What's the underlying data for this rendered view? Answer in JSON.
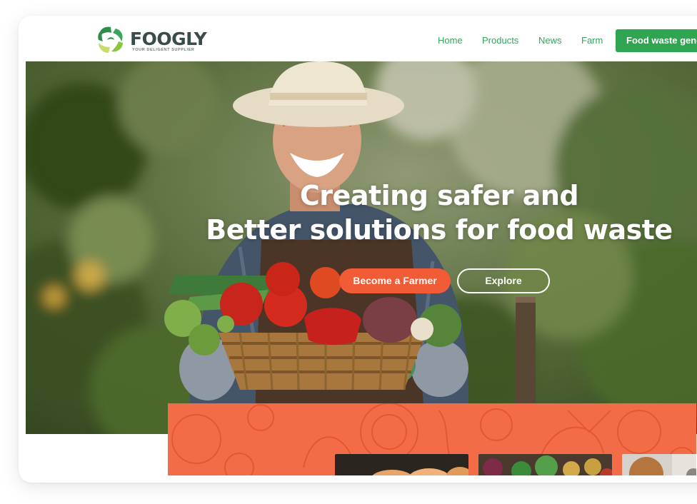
{
  "brand": {
    "name": "FOOGLY",
    "tagline": "YOUR DELIGENT SUPPLIER",
    "colors": {
      "primary_green": "#2fa552",
      "accent_orange": "#f15b36",
      "text_dark": "#3b4a4a"
    }
  },
  "nav": {
    "links": [
      "Home",
      "Products",
      "News",
      "Farm"
    ],
    "cta_label": "Food waste generator"
  },
  "hero": {
    "title_line1": "Creating safer and",
    "title_line2": "Better solutions for food waste",
    "primary_button": "Become a Farmer",
    "secondary_button": "Explore"
  },
  "icons": [
    "foogly-logo-icon"
  ]
}
